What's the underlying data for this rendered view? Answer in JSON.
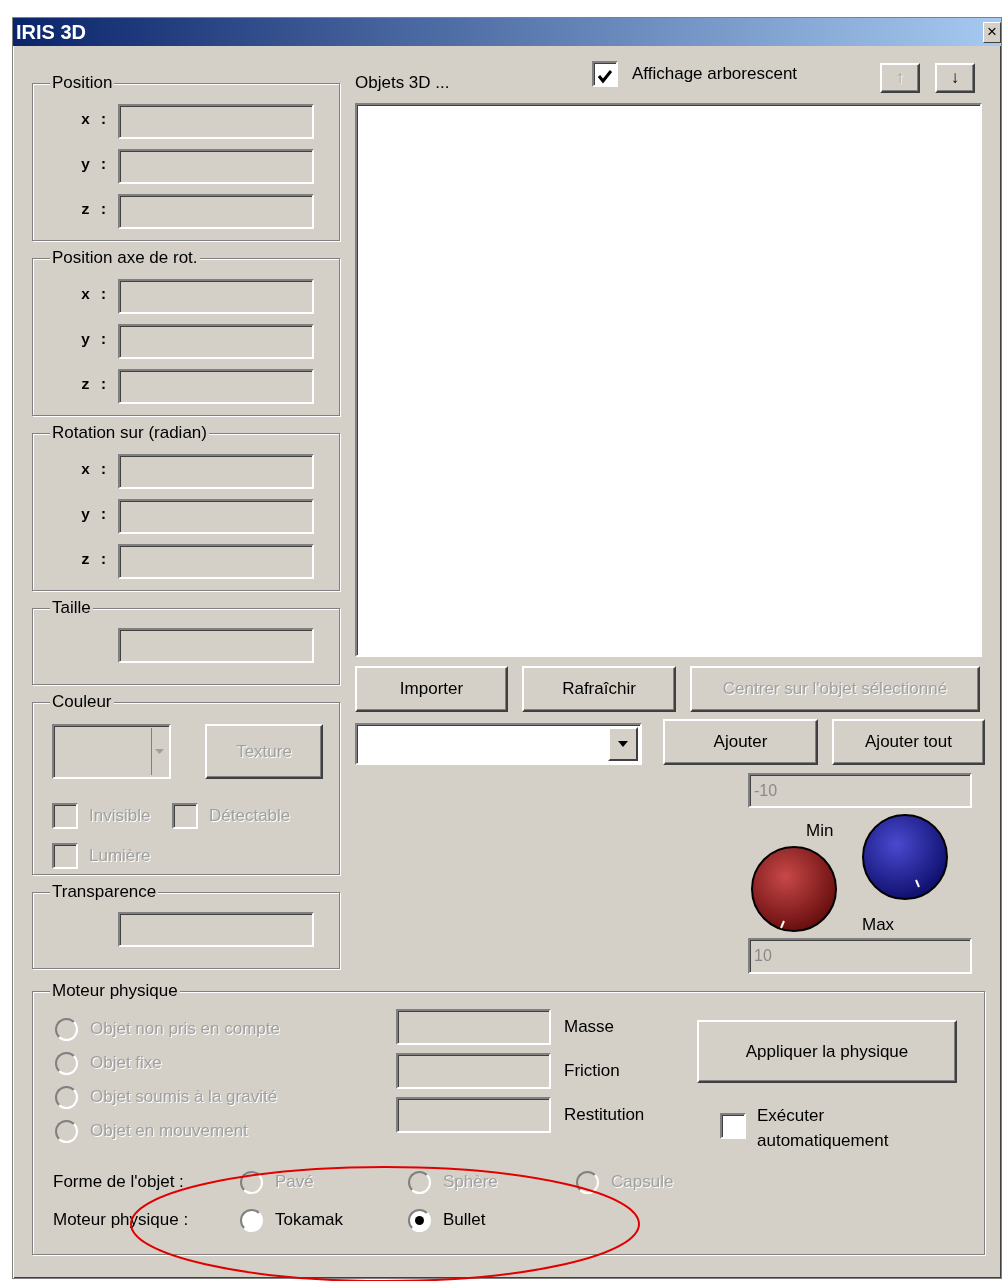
{
  "window": {
    "title": "IRIS 3D",
    "close": "×"
  },
  "groups": [
    {
      "title": "Position",
      "fields": [
        {
          "label": "x :",
          "disabled": true
        },
        {
          "label": "y :",
          "disabled": true
        },
        {
          "label": "z :",
          "disabled": true
        }
      ]
    },
    {
      "title": "Position axe de rot.",
      "fields": [
        {
          "label": "x :",
          "disabled": true
        },
        {
          "label": "y :",
          "disabled": true
        },
        {
          "label": "z :",
          "disabled": true
        }
      ]
    },
    {
      "title": "Rotation sur (radian)",
      "fields": [
        {
          "label": "x :",
          "disabled": true
        },
        {
          "label": "y :",
          "disabled": true
        },
        {
          "label": "z :",
          "disabled": true
        }
      ]
    },
    {
      "title": "Taille",
      "fields": [
        {
          "disabled": true
        }
      ]
    }
  ],
  "color_group": {
    "title": "Couleur",
    "color_dropdown": {
      "disabled": true
    },
    "texture_button": {
      "label": "Texture",
      "disabled": true
    },
    "checkboxes": [
      {
        "label": "Invisible",
        "checked": false,
        "disabled": true
      },
      {
        "label": "Détectable",
        "checked": false,
        "disabled": true
      },
      {
        "label": "Lumière",
        "checked": false,
        "disabled": true
      }
    ]
  },
  "transparency_group": {
    "title": "Transparence",
    "field": {
      "disabled": true
    }
  },
  "objects": {
    "label": "Objets 3D ...",
    "tree_view": {
      "label": "Affichage arborescent",
      "checked": true
    },
    "move_buttons": [
      {
        "label": "↑",
        "disabled": true
      },
      {
        "label": "↓",
        "disabled": false
      }
    ],
    "buttons": [
      {
        "label": "Importer",
        "disabled": false
      },
      {
        "label": "Rafraîchir",
        "disabled": false
      },
      {
        "label": "Centrer sur l'objet sélectionné",
        "disabled": true
      }
    ],
    "add_buttons": [
      {
        "label": "Ajouter",
        "disabled": false
      },
      {
        "label": "Ajouter tout",
        "disabled": false
      }
    ]
  },
  "range": {
    "min_value": "-10",
    "min_label": "Min",
    "max_label": "Max",
    "max_value": "10"
  },
  "physics": {
    "title": "Moteur physique",
    "modes": [
      {
        "label": "Objet non pris en compte",
        "selected": false,
        "disabled": true
      },
      {
        "label": "Objet fixe",
        "selected": false,
        "disabled": true
      },
      {
        "label": "Objet soumis à la gravité",
        "selected": false,
        "disabled": true
      },
      {
        "label": "Objet en mouvement",
        "selected": false,
        "disabled": true
      }
    ],
    "properties": [
      {
        "label": "Masse",
        "disabled": true
      },
      {
        "label": "Friction",
        "disabled": true
      },
      {
        "label": "Restitution",
        "disabled": true
      }
    ],
    "apply_button": "Appliquer la physique",
    "auto_run": {
      "label": "Exécuter automatiquement",
      "checked": false
    },
    "shape": {
      "label": "Forme de l'objet :",
      "options": [
        {
          "label": "Pavé",
          "selected": false,
          "disabled": true
        },
        {
          "label": "Sphère",
          "selected": false,
          "disabled": true
        },
        {
          "label": "Capsule",
          "selected": false,
          "disabled": true
        }
      ]
    },
    "engine": {
      "label": "Moteur physique :",
      "options": [
        {
          "label": "Tokamak",
          "selected": false,
          "disabled": false
        },
        {
          "label": "Bullet",
          "selected": true,
          "disabled": false
        }
      ]
    }
  }
}
